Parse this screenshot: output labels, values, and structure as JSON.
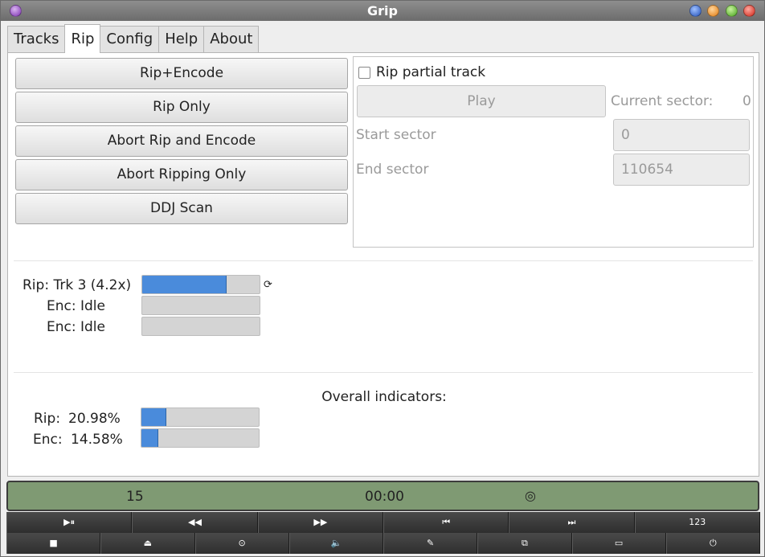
{
  "window": {
    "title": "Grip"
  },
  "tabs": [
    {
      "label": "Tracks"
    },
    {
      "label": "Rip"
    },
    {
      "label": "Config"
    },
    {
      "label": "Help"
    },
    {
      "label": "About"
    }
  ],
  "rip": {
    "buttons": {
      "rip_encode": "Rip+Encode",
      "rip_only": "Rip Only",
      "abort_rip_encode": "Abort Rip and Encode",
      "abort_ripping_only": "Abort Ripping Only",
      "ddj_scan": "DDJ Scan"
    },
    "partial": {
      "checkbox_label": "Rip partial track",
      "checked": false,
      "play_label": "Play",
      "current_sector_label": "Current sector:",
      "current_sector_value": "0",
      "start_sector_label": "Start sector",
      "start_sector_value": "0",
      "end_sector_label": "End sector",
      "end_sector_value": "110654"
    },
    "status": {
      "rip_label": "Rip: Trk 3 (4.2x)",
      "rip_progress": 0.72,
      "enc1_label": "Enc: Idle",
      "enc1_progress": 0,
      "enc2_label": "Enc: Idle",
      "enc2_progress": 0
    },
    "overall": {
      "title": "Overall indicators:",
      "rip_label": "Rip:",
      "rip_value": "20.98%",
      "rip_progress": 0.2098,
      "enc_label": "Enc:",
      "enc_value": "14.58%",
      "enc_progress": 0.1458
    }
  },
  "lcd": {
    "track": "15",
    "time": "00:00",
    "icon": "cd-icon"
  },
  "controls": {
    "row1": [
      {
        "name": "play-pause-button",
        "glyph": "▶⏸"
      },
      {
        "name": "rewind-button",
        "glyph": "◀◀"
      },
      {
        "name": "fast-forward-button",
        "glyph": "▶▶"
      },
      {
        "name": "prev-track-button",
        "glyph": "⏮"
      },
      {
        "name": "next-track-button",
        "glyph": "⏭"
      },
      {
        "name": "track-number-button",
        "glyph": "123"
      }
    ],
    "row2": [
      {
        "name": "stop-button",
        "glyph": "■"
      },
      {
        "name": "eject-button",
        "glyph": "⏏"
      },
      {
        "name": "cd-select-button",
        "glyph": "⊙"
      },
      {
        "name": "volume-button",
        "glyph": "🔈"
      },
      {
        "name": "edit-button",
        "glyph": "✎"
      },
      {
        "name": "shuffle-button",
        "glyph": "⧉"
      },
      {
        "name": "minimize-button",
        "glyph": "▭"
      },
      {
        "name": "power-button",
        "glyph": "⏻"
      }
    ]
  },
  "colors": {
    "progress_fill": "#4a8bdb",
    "lcd_background": "#7f9a73"
  }
}
